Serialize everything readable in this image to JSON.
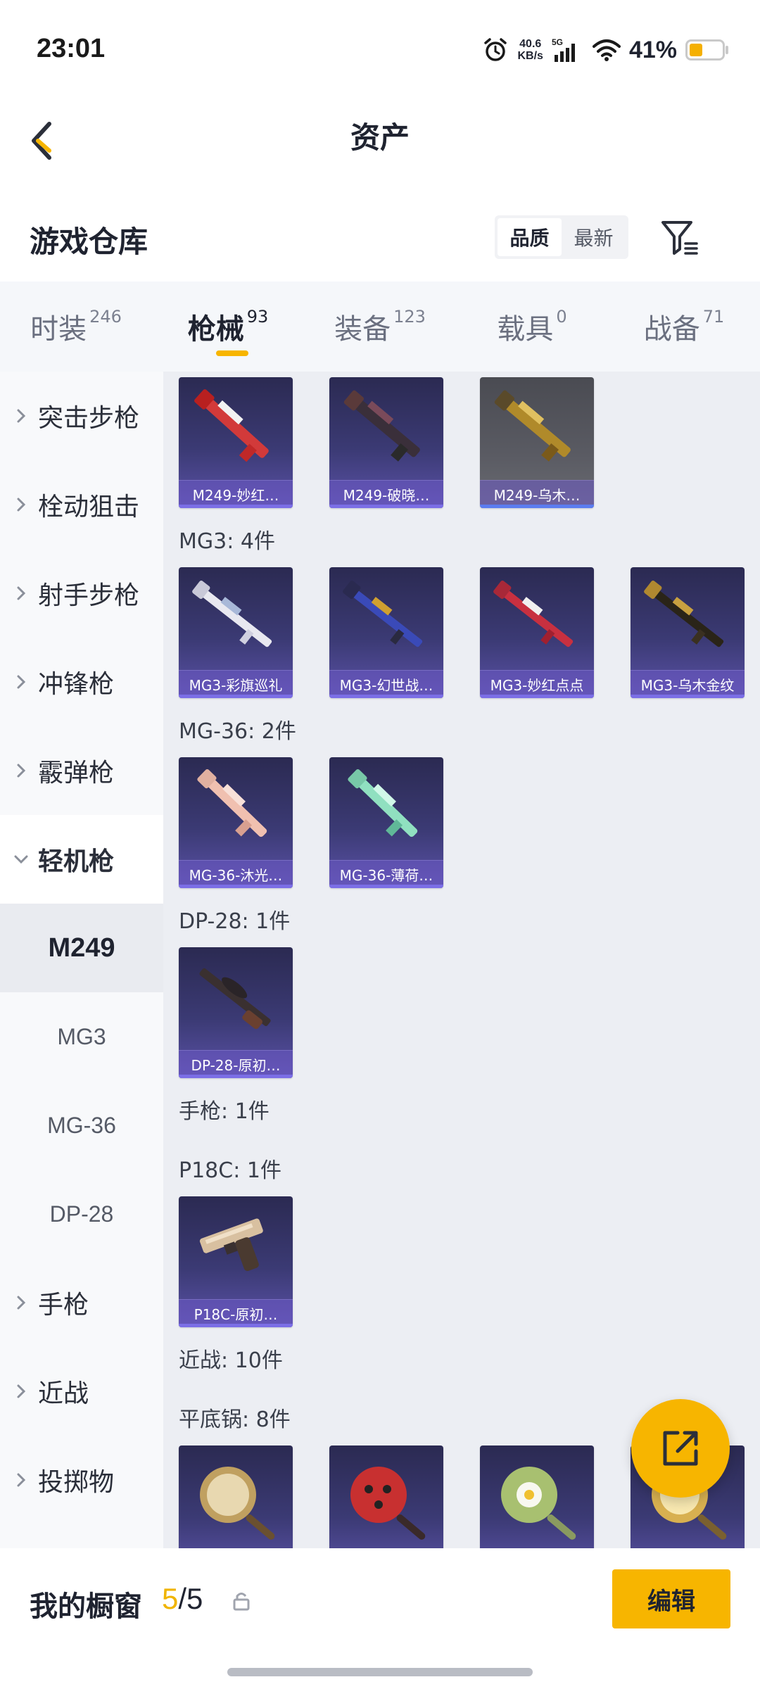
{
  "status_bar": {
    "time": "23:01",
    "net_speed_value": "40.6",
    "net_speed_unit": "KB/s",
    "network": "5G",
    "battery_percent": "41%",
    "battery_level": 0.41,
    "icons": [
      "alarm-icon",
      "signal-icon",
      "wifi-icon",
      "battery-icon"
    ]
  },
  "header": {
    "title": "资产",
    "back_icon": "chevron-left-icon"
  },
  "warehouse": {
    "title": "游戏仓库",
    "sort_options": [
      "品质",
      "最新"
    ],
    "sort_selected": "品质",
    "filter_icon": "filter-icon"
  },
  "category_tabs": [
    {
      "label": "时装",
      "count": "246",
      "active": false
    },
    {
      "label": "枪械",
      "count": "93",
      "active": true
    },
    {
      "label": "装备",
      "count": "123",
      "active": false
    },
    {
      "label": "载具",
      "count": "0",
      "active": false
    },
    {
      "label": "战备",
      "count": "71",
      "active": false
    }
  ],
  "sidebar": {
    "items": [
      {
        "label": "突击步枪"
      },
      {
        "label": "栓动狙击"
      },
      {
        "label": "射手步枪"
      },
      {
        "label": "冲锋枪"
      },
      {
        "label": "霰弹枪"
      },
      {
        "label": "轻机枪"
      }
    ],
    "subitems": [
      {
        "label": "M249"
      },
      {
        "label": "MG3"
      },
      {
        "label": "MG-36"
      },
      {
        "label": "DP-28"
      }
    ],
    "items_after": [
      {
        "label": "手枪"
      },
      {
        "label": "近战"
      },
      {
        "label": "投掷物"
      }
    ]
  },
  "content": {
    "groups": [
      {
        "label": "MG3: 4件"
      },
      {
        "label": "MG-36: 2件"
      },
      {
        "label": "DP-28: 1件"
      },
      {
        "label": "手枪: 1件"
      },
      {
        "label": "P18C: 1件"
      },
      {
        "label": "近战: 10件"
      },
      {
        "label": "平底锅: 8件"
      }
    ],
    "m249_items": [
      "M249-妙红…",
      "M249-破晓…",
      "M249-乌木…"
    ],
    "mg3_items": [
      "MG3-彩旗巡礼",
      "MG3-幻世战…",
      "MG3-妙红点点",
      "MG3-乌木金纹"
    ],
    "mg36_items": [
      "MG-36-沐光…",
      "MG-36-薄荷…"
    ],
    "dp28_items": [
      "DP-28-原初…"
    ],
    "p18c_items": [
      "P18C-原初…"
    ]
  },
  "fab": {
    "icon": "share-external-icon"
  },
  "bottom_bar": {
    "label": "我的橱窗",
    "current": "5",
    "total": "/5",
    "lock_icon": "lock-icon",
    "edit_label": "编辑"
  },
  "colors": {
    "accent": "#f7b500",
    "card_purple": "#3b3a74",
    "content_bg": "#eceef3"
  }
}
